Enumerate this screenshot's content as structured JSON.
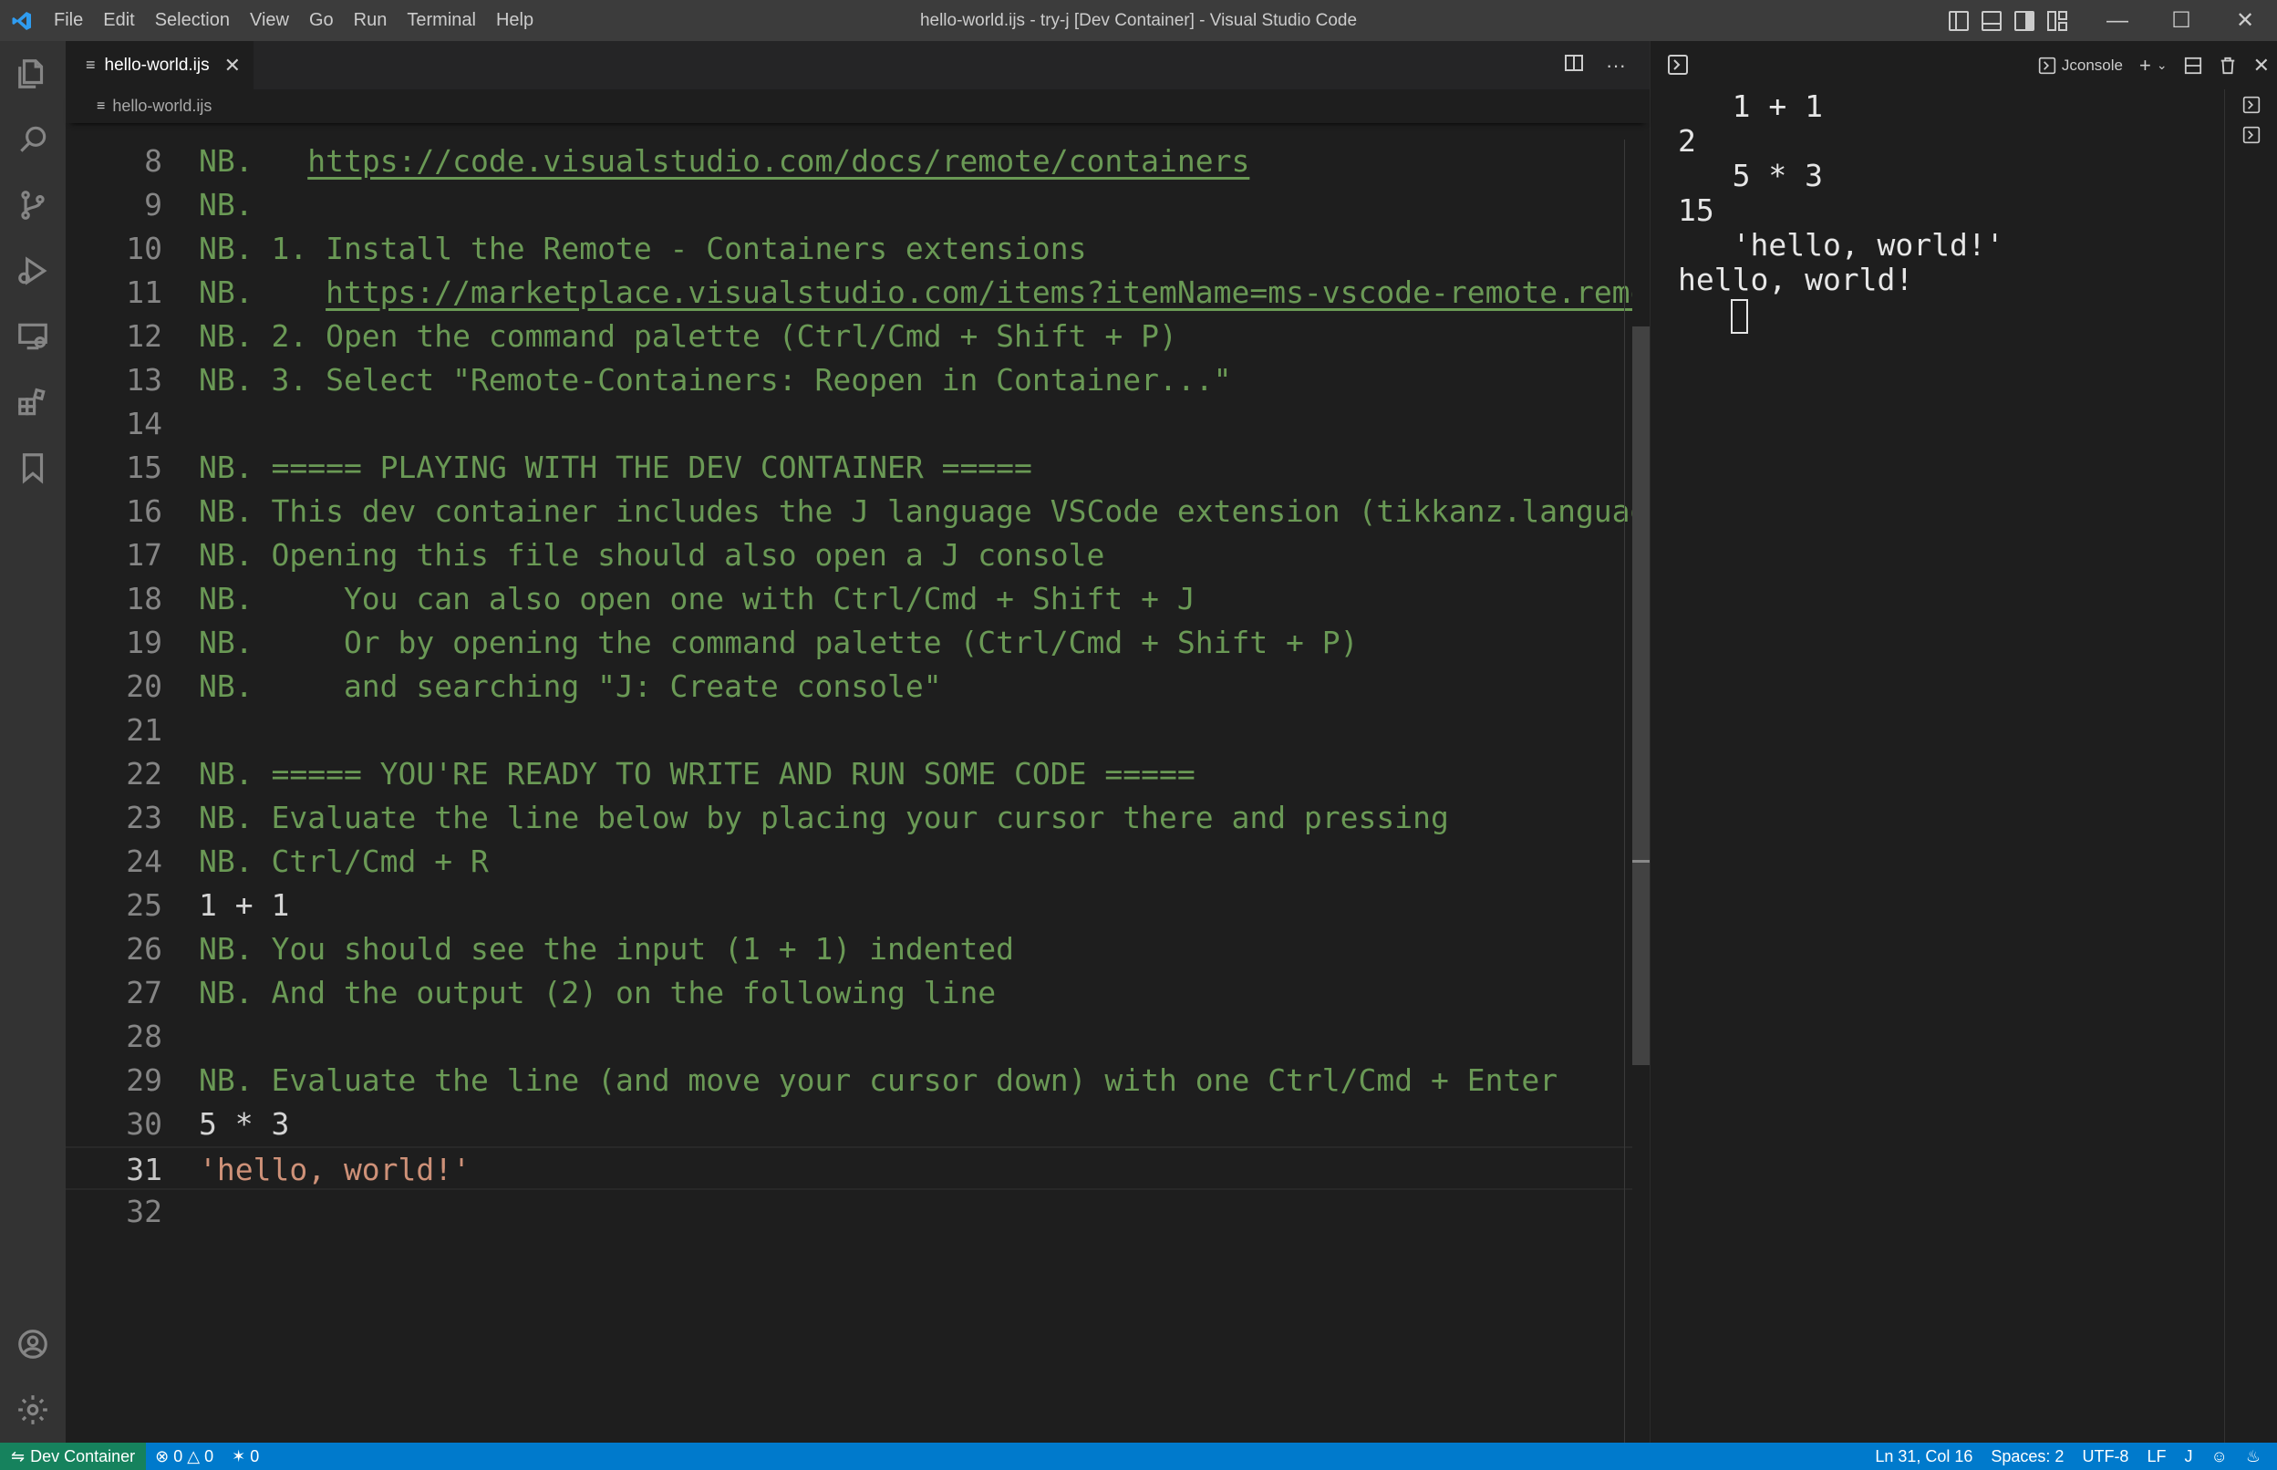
{
  "titlebar": {
    "menu": [
      "File",
      "Edit",
      "Selection",
      "View",
      "Go",
      "Run",
      "Terminal",
      "Help"
    ],
    "title": "hello-world.ijs - try-j [Dev Container] - Visual Studio Code"
  },
  "activitybar": {
    "items": [
      "explorer-icon",
      "search-icon",
      "source-control-icon",
      "run-debug-icon",
      "remote-explorer-icon",
      "extensions-icon",
      "bookmarks-icon"
    ],
    "bottom": [
      "accounts-icon",
      "manage-gear-icon"
    ]
  },
  "editor": {
    "tab_label": "hello-world.ijs",
    "breadcrumb": "hello-world.ijs",
    "current_line": 31,
    "lines": [
      {
        "n": "8",
        "t": "NB.   ",
        "link": "https://code.visualstudio.com/docs/remote/containers",
        "kind": "comment"
      },
      {
        "n": "9",
        "t": "NB.",
        "kind": "comment"
      },
      {
        "n": "10",
        "t": "NB. 1. Install the Remote - Containers extensions",
        "kind": "comment"
      },
      {
        "n": "11",
        "t": "NB.    ",
        "link": "https://marketplace.visualstudio.com/items?itemName=ms-vscode-remote.remote-containers",
        "kind": "comment"
      },
      {
        "n": "12",
        "t": "NB. 2. Open the command palette (Ctrl/Cmd + Shift + P)",
        "kind": "comment"
      },
      {
        "n": "13",
        "t": "NB. 3. Select \"Remote-Containers: Reopen in Container...\"",
        "kind": "comment"
      },
      {
        "n": "14",
        "t": "",
        "kind": "comment"
      },
      {
        "n": "15",
        "t": "NB. ===== PLAYING WITH THE DEV CONTAINER =====",
        "kind": "comment"
      },
      {
        "n": "16",
        "t": "NB. This dev container includes the J language VSCode extension (tikkanz.language-j)",
        "kind": "comment"
      },
      {
        "n": "17",
        "t": "NB. Opening this file should also open a J console",
        "kind": "comment"
      },
      {
        "n": "18",
        "t": "NB.     You can also open one with Ctrl/Cmd + Shift + J",
        "kind": "comment"
      },
      {
        "n": "19",
        "t": "NB.     Or by opening the command palette (Ctrl/Cmd + Shift + P)",
        "kind": "comment"
      },
      {
        "n": "20",
        "t": "NB.     and searching \"J: Create console\"",
        "kind": "comment"
      },
      {
        "n": "21",
        "t": "",
        "kind": "comment"
      },
      {
        "n": "22",
        "t": "NB. ===== YOU'RE READY TO WRITE AND RUN SOME CODE =====",
        "kind": "comment"
      },
      {
        "n": "23",
        "t": "NB. Evaluate the line below by placing your cursor there and pressing",
        "kind": "comment"
      },
      {
        "n": "24",
        "t": "NB. Ctrl/Cmd + R",
        "kind": "comment"
      },
      {
        "n": "25",
        "t": "1 + 1",
        "kind": "plain"
      },
      {
        "n": "26",
        "t": "NB. You should see the input (1 + 1) indented",
        "kind": "comment"
      },
      {
        "n": "27",
        "t": "NB. And the output (2) on the following line",
        "kind": "comment"
      },
      {
        "n": "28",
        "t": "",
        "kind": "comment"
      },
      {
        "n": "29",
        "t": "NB. Evaluate the line (and move your cursor down) with one Ctrl/Cmd + Enter",
        "kind": "comment"
      },
      {
        "n": "30",
        "t": "5 * 3",
        "kind": "plain"
      },
      {
        "n": "31",
        "t": "'hello, world!'",
        "kind": "str"
      },
      {
        "n": "32",
        "t": "",
        "kind": "comment"
      }
    ]
  },
  "panel": {
    "terminal_name": "Jconsole",
    "output": [
      "   1 + 1",
      "2",
      "   5 * 3",
      "15",
      "   'hello, world!'",
      "hello, world!"
    ]
  },
  "statusbar": {
    "remote": "Dev Container",
    "errors": "0",
    "warnings": "0",
    "ports": "0",
    "position": "Ln 31, Col 16",
    "spaces": "Spaces: 2",
    "encoding": "UTF-8",
    "eol": "LF",
    "language": "J"
  },
  "colors": {
    "comment": "#6a9955",
    "string": "#ce9178",
    "statusbar": "#007acc",
    "remote": "#16825d"
  }
}
